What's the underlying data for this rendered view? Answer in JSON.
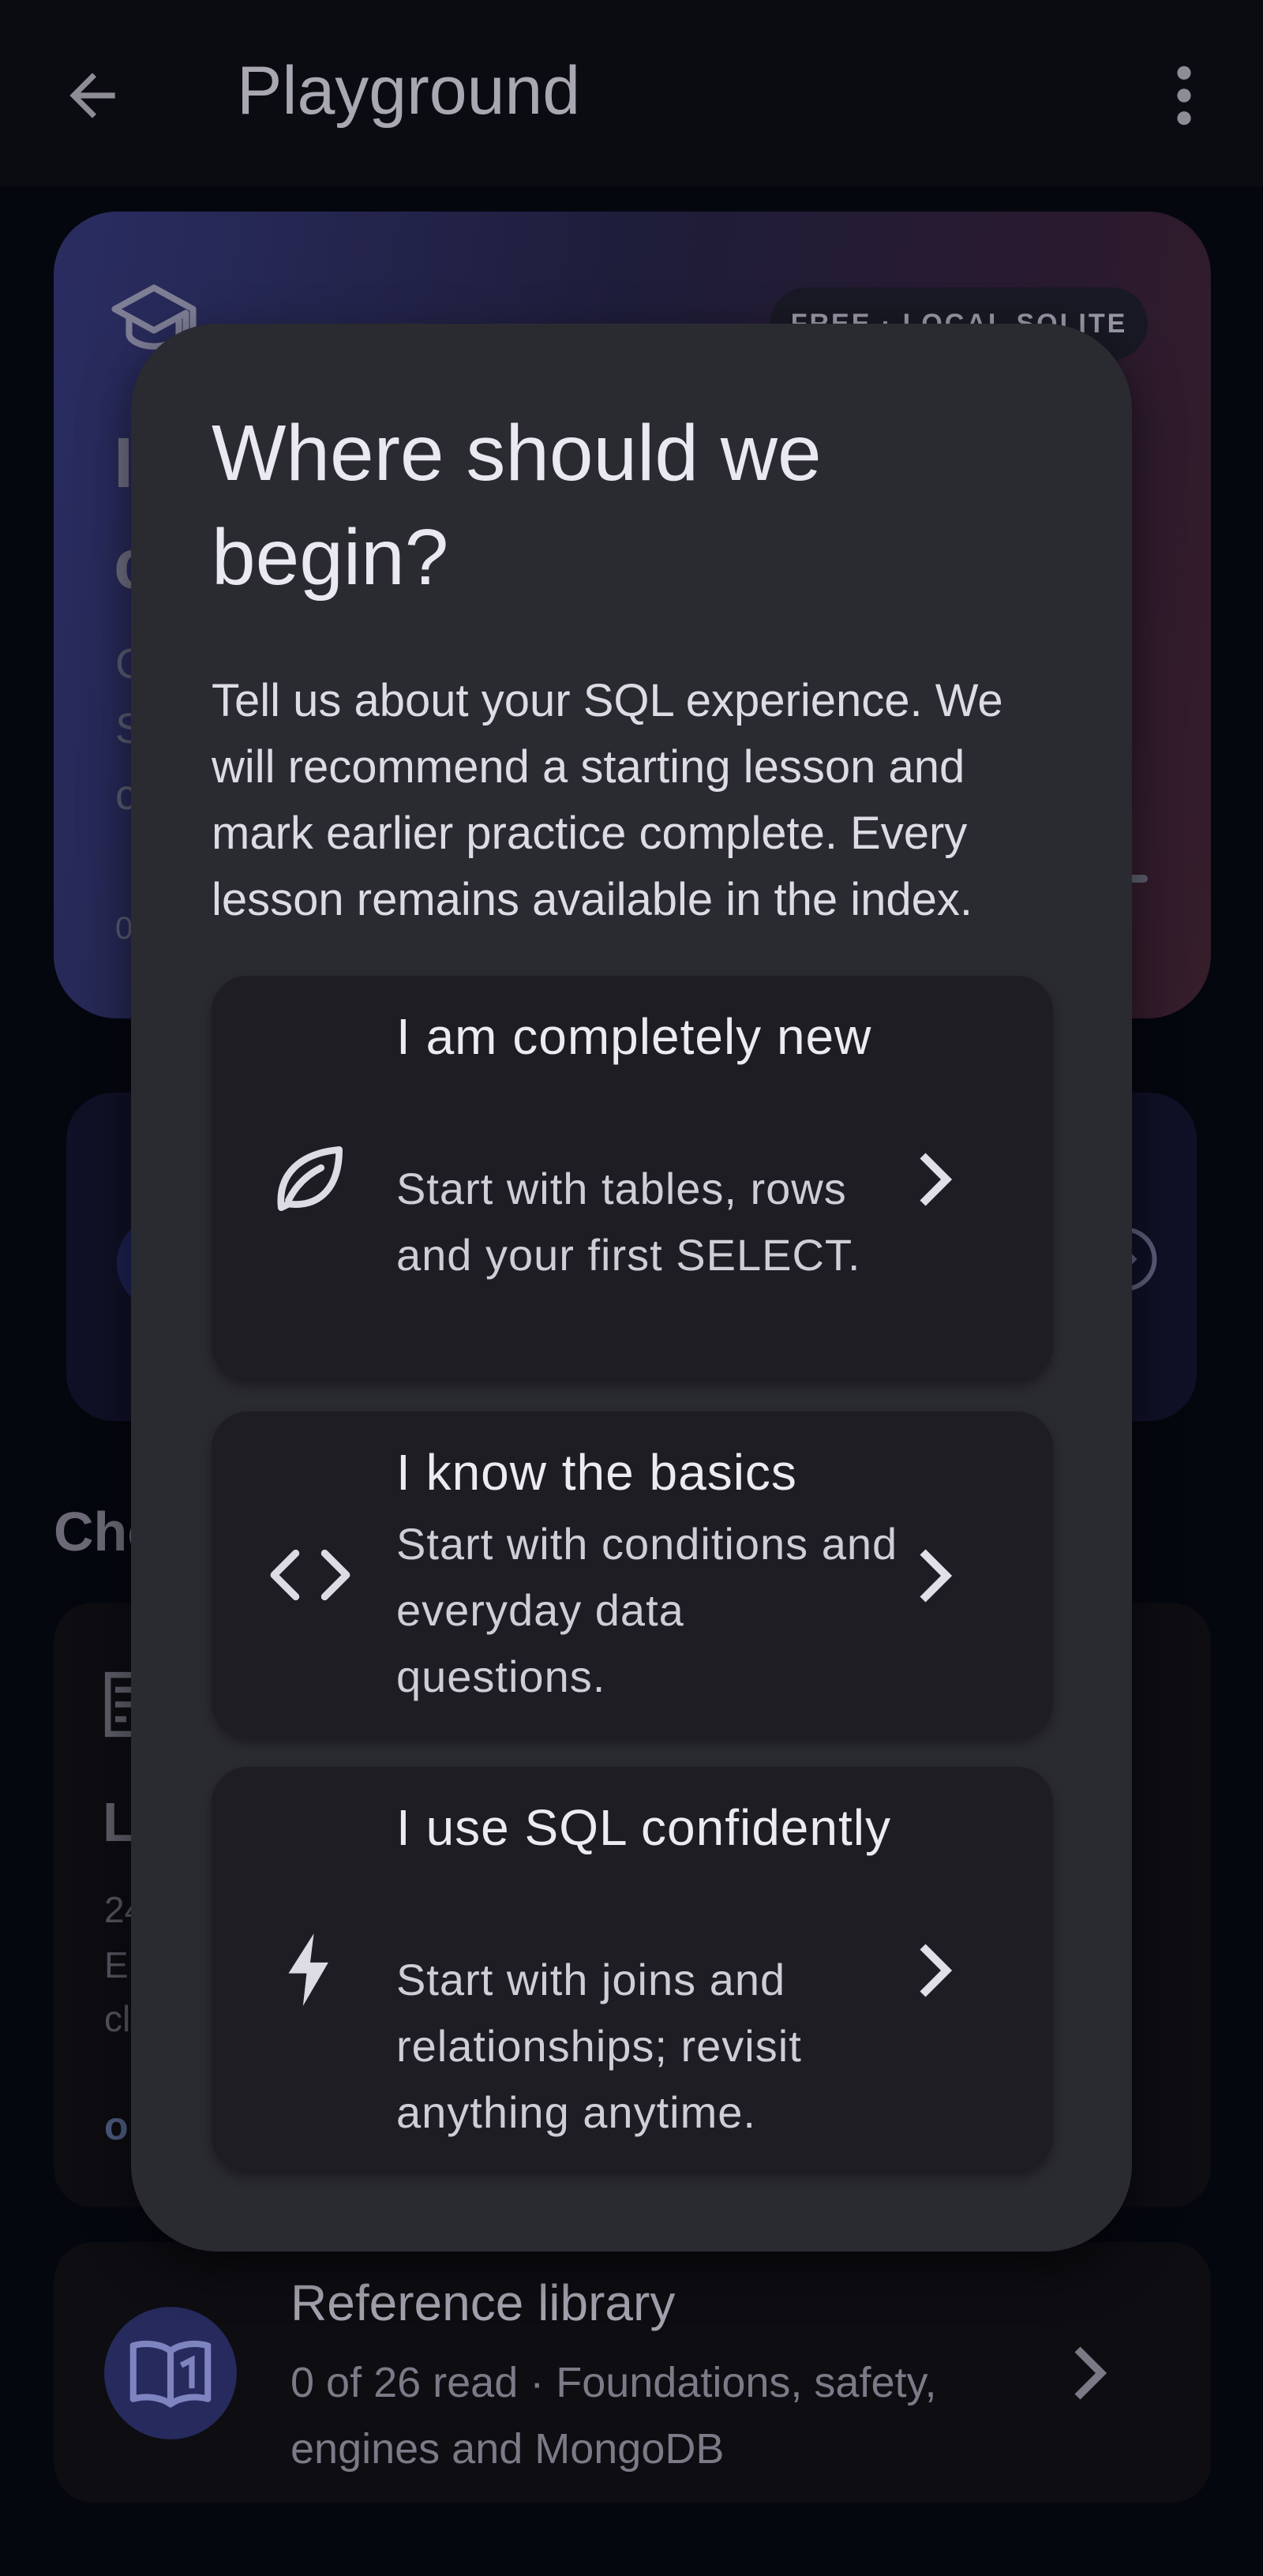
{
  "appbar": {
    "title": "Playground"
  },
  "hero": {
    "badge": "FREE · LOCAL SQLITE",
    "title_fragment_1": "I",
    "title_fragment_2": "c",
    "text_fragment_1": "C",
    "text_fragment_2": "S",
    "text_fragment_3": "c",
    "progress_fragment": "0"
  },
  "section": {
    "heading_fragment": "Cho"
  },
  "lessons_card": {
    "title_fragment": "L",
    "line1_fragment": "24",
    "line2_fragment": "E",
    "line3_fragment": "cl",
    "action_fragment": "o"
  },
  "reference": {
    "title": "Reference library",
    "subtitle": "0 of 26 read · Foundations, safety, engines and MongoDB"
  },
  "dialog": {
    "title": "Where should we begin?",
    "body": "Tell us about your SQL experience. We will recommend a starting lesson and mark earlier practice complete. Every lesson remains available in the index.",
    "options": [
      {
        "title": "I am completely new",
        "description": "Start with tables, rows and your first SELECT.",
        "icon": "leaf-icon"
      },
      {
        "title": "I know the basics",
        "description": "Start with conditions and everyday data questions.",
        "icon": "code-icon"
      },
      {
        "title": "I use SQL confidently",
        "description": "Start with joins and relationships; revisit anything anytime.",
        "icon": "bolt-icon"
      }
    ]
  }
}
